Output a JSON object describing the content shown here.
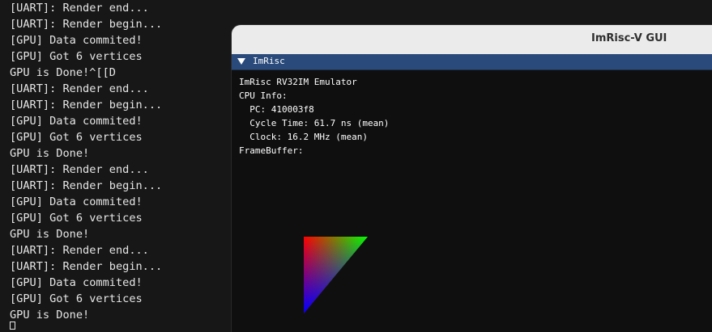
{
  "terminal": {
    "lines": [
      "[UART]: Render end...",
      "[UART]: Render begin...",
      "[GPU] Data commited!",
      "[GPU] Got 6 vertices",
      "GPU is Done!^[[D",
      "[UART]: Render end...",
      "[UART]: Render begin...",
      "[GPU] Data commited!",
      "[GPU] Got 6 vertices",
      "GPU is Done!",
      "[UART]: Render end...",
      "[UART]: Render begin...",
      "[GPU] Data commited!",
      "[GPU] Got 6 vertices",
      "GPU is Done!",
      "[UART]: Render end...",
      "[UART]: Render begin...",
      "[GPU] Data commited!",
      "[GPU] Got 6 vertices",
      "GPU is Done!"
    ]
  },
  "window": {
    "title": "ImRisc-V GUI"
  },
  "panel": {
    "header_title": "ImRisc",
    "collapse_icon": "triangle-down-icon",
    "emulator_name": "ImRisc RV32IM Emulator",
    "cpu_info_label": "CPU Info:",
    "pc": "  PC: 410003f8",
    "cycle_time": "  Cycle Time: 61.7 ns (mean)",
    "clock": "  Clock: 16.2 MHz (mean)",
    "framebuffer_label": "FrameBuffer:"
  },
  "colors": {
    "vertex_top_left": "#ff0000",
    "vertex_top_right": "#00ff00",
    "vertex_bottom": "#0000ff"
  }
}
